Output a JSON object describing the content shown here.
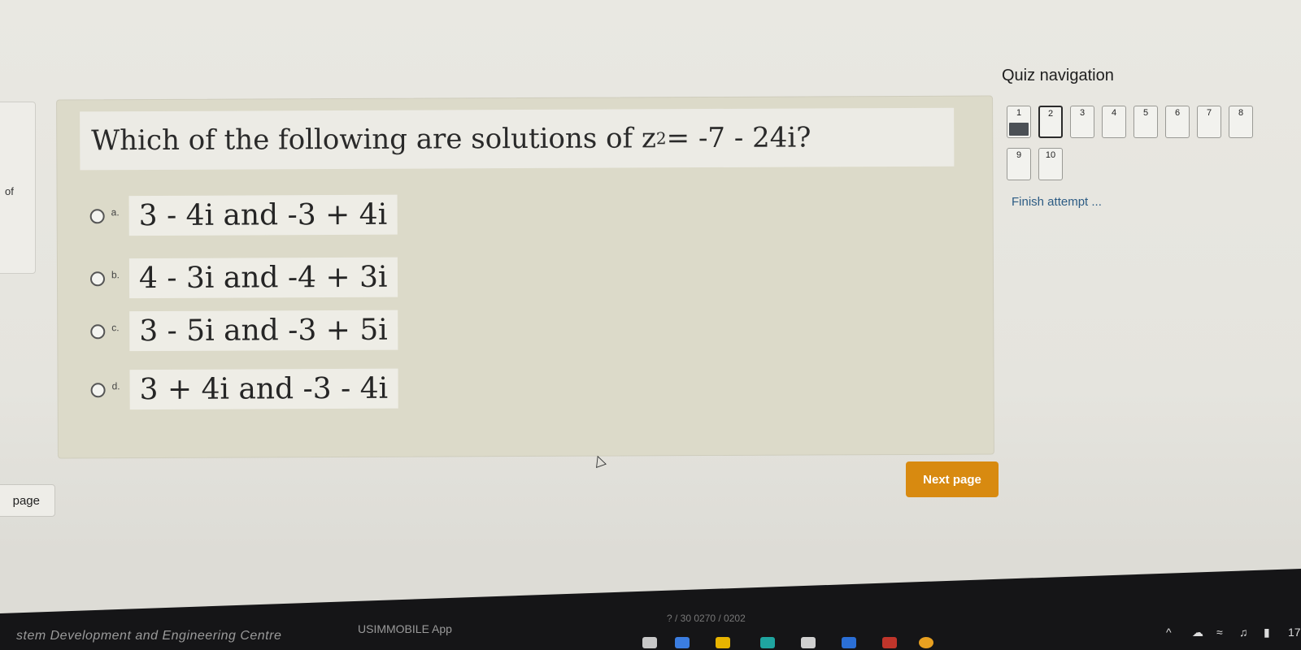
{
  "left_panel": {
    "of_text": "of",
    "prev_button_label": "page"
  },
  "question": {
    "prefix": "Which of the following are solutions of z",
    "exponent": "2",
    "suffix": " = -7 - 24i?"
  },
  "options": [
    {
      "letter": "a.",
      "text": "3 - 4i and -3 + 4i"
    },
    {
      "letter": "b.",
      "text": "4 - 3i and -4 + 3i"
    },
    {
      "letter": "c.",
      "text": "3 - 5i and -3 + 5i"
    },
    {
      "letter": "d.",
      "text": "3 + 4i and -3 - 4i"
    }
  ],
  "quiz_nav": {
    "title": "Quiz navigation",
    "buttons": [
      {
        "num": "1",
        "state": "answered"
      },
      {
        "num": "2",
        "state": "current"
      },
      {
        "num": "3",
        "state": "none"
      },
      {
        "num": "4",
        "state": "none"
      },
      {
        "num": "5",
        "state": "none"
      },
      {
        "num": "6",
        "state": "none"
      },
      {
        "num": "7",
        "state": "none"
      },
      {
        "num": "8",
        "state": "none"
      },
      {
        "num": "9",
        "state": "none"
      },
      {
        "num": "10",
        "state": "none"
      }
    ],
    "finish_label": "Finish attempt ..."
  },
  "next_button_label": "Next page",
  "taskbar": {
    "left_text": "stem Development and Engineering Centre",
    "mid_text": "USIMMOBILE App",
    "date_text": "? / 30 0270 / 0202",
    "clock": "17"
  },
  "colors": {
    "accent": "#d88a10",
    "answered": "#4b5055",
    "link": "#2d5c84"
  }
}
